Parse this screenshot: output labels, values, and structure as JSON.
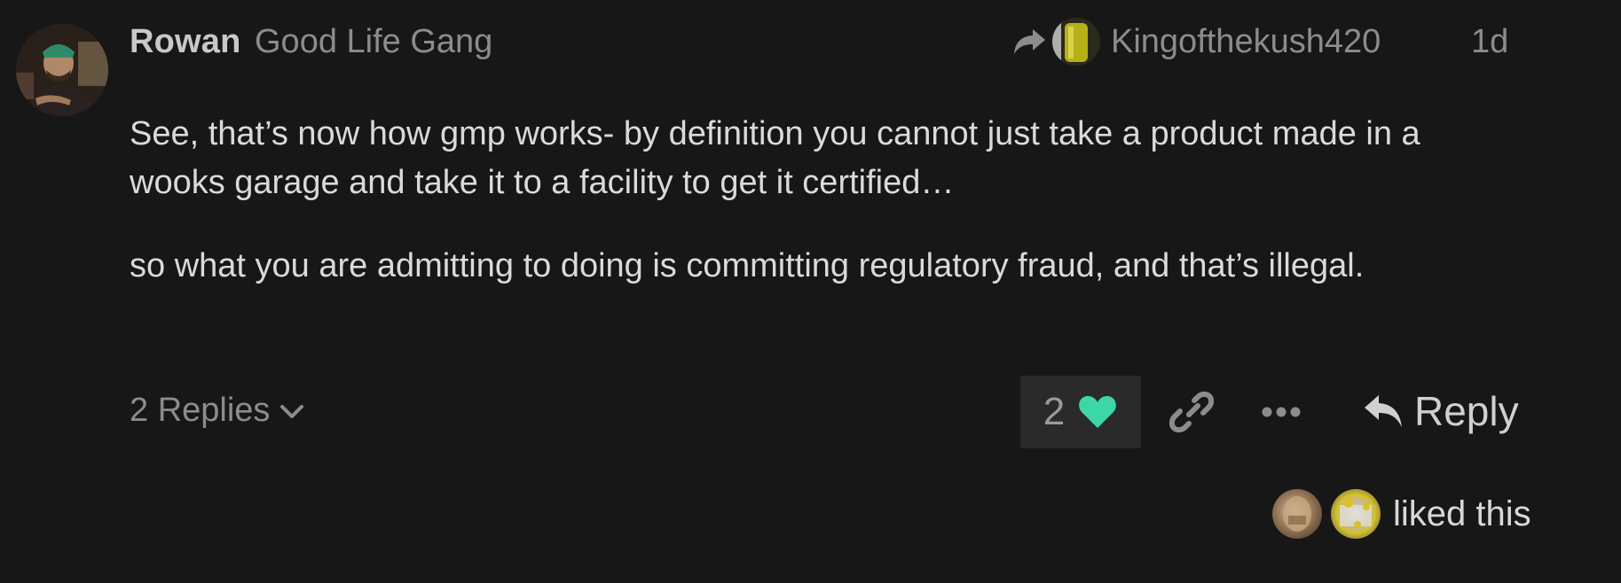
{
  "post": {
    "author": {
      "name": "Rowan",
      "title": "Good Life Gang"
    },
    "reply_to": {
      "username": "Kingofthekush420"
    },
    "date": "1d",
    "body": [
      "See, that’s now how gmp works- by definition you cannot just take a product made in a wooks garage and take it to a facility to get it certified…",
      "so what you are admitting to doing is committing regulatory fraud, and that’s illegal."
    ],
    "replies_label": "2 Replies",
    "like_count": "2",
    "reply_label": "Reply",
    "liked_by_text": "liked this",
    "icons": {
      "share": "share-arrow-icon",
      "heart": "heart-icon",
      "link": "link-icon",
      "more": "ellipsis-icon",
      "reply": "reply-icon",
      "chevron": "chevron-down-icon"
    },
    "colors": {
      "background": "#171717",
      "like_accent": "#3dd6a6",
      "like_bg": "#2a2a2a",
      "muted_text": "#8c8c8c"
    }
  }
}
